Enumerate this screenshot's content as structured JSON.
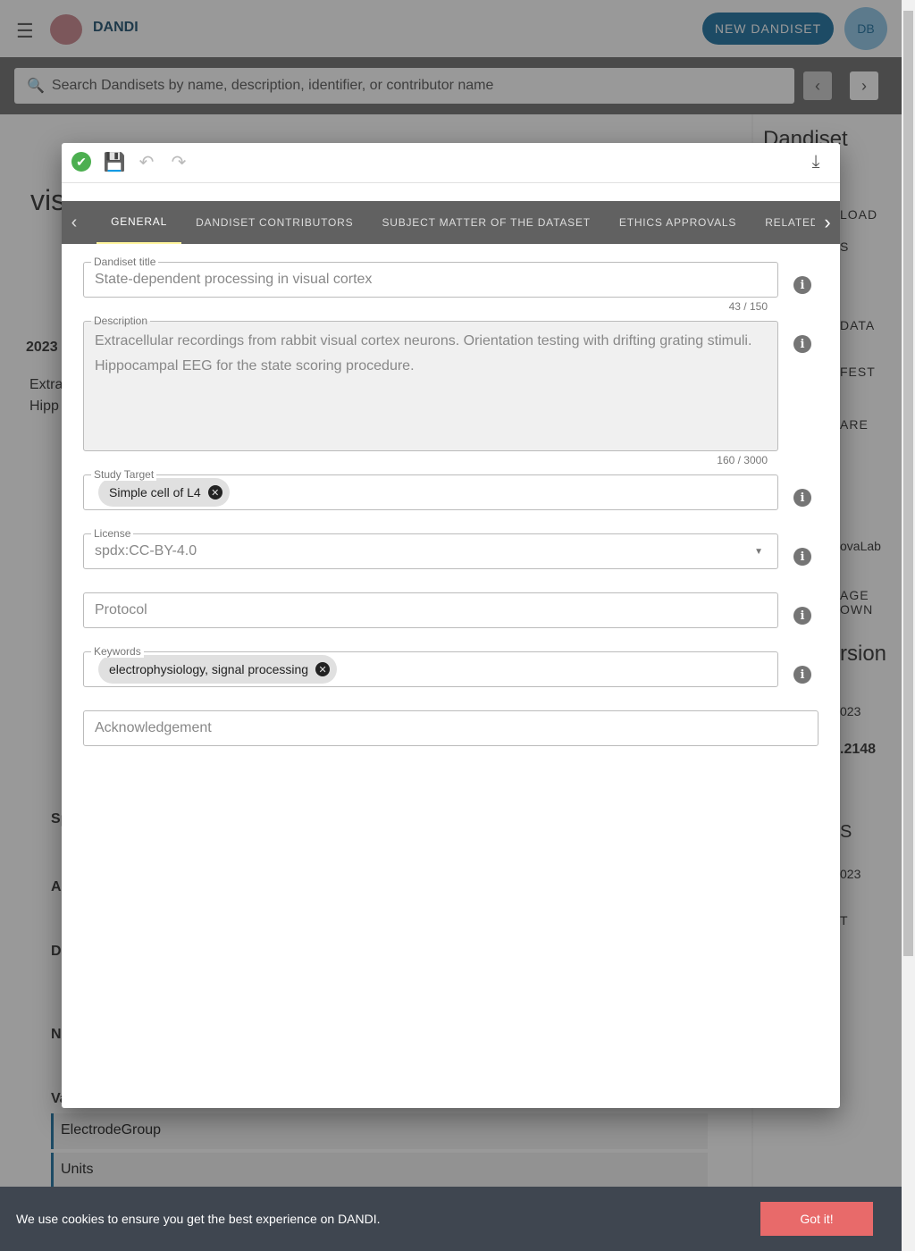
{
  "header": {
    "brand": "DANDI",
    "new_button": "NEW DANDISET",
    "avatar": "DB"
  },
  "search": {
    "placeholder": "Search Dandisets by name, description, identifier, or contributor name"
  },
  "background": {
    "left": [
      "vis",
      "2023",
      "Extra",
      "Hipp",
      "Sp",
      "A",
      "Da",
      "N",
      "Va",
      "ElectrodeGroup",
      "Units"
    ],
    "right": [
      "Dandiset",
      "LOAD",
      "S",
      "DATA",
      "FEST",
      "ARE",
      "ovaLab",
      "AGE OWN",
      "rsion",
      "023",
      ".2148",
      "S",
      "023",
      "T"
    ]
  },
  "modal": {
    "tabs": [
      "General",
      "Dandiset Contributors",
      "Subject matter of the dataset",
      "Ethics Approvals",
      "Related Res"
    ],
    "active_tab": "General",
    "fields": {
      "title": {
        "label": "Dandiset title",
        "value": "State-dependent processing in visual cortex",
        "counter": "43 / 150"
      },
      "description": {
        "label": "Description",
        "value": "Extracellular recordings from rabbit visual cortex neurons. Orientation testing with drifting grating stimuli. Hippocampal EEG for the state scoring procedure.",
        "counter": "160 / 3000"
      },
      "study_target": {
        "label": "Study Target",
        "chips": [
          "Simple cell of L4"
        ]
      },
      "license": {
        "label": "License",
        "value": "spdx:CC-BY-4.0"
      },
      "protocol": {
        "placeholder": "Protocol"
      },
      "keywords": {
        "label": "Keywords",
        "chips": [
          "electrophysiology, signal processing"
        ]
      },
      "acknowledgement": {
        "placeholder": "Acknowledgement"
      }
    }
  },
  "cookie": {
    "text": "We use cookies to ensure you get the best experience on DANDI.",
    "button": "Got it!"
  },
  "colors": {
    "brand": "#1a6fa0",
    "valid": "#4caf50",
    "cookie_button": "#e86a6a",
    "tab_bar": "#616161"
  }
}
